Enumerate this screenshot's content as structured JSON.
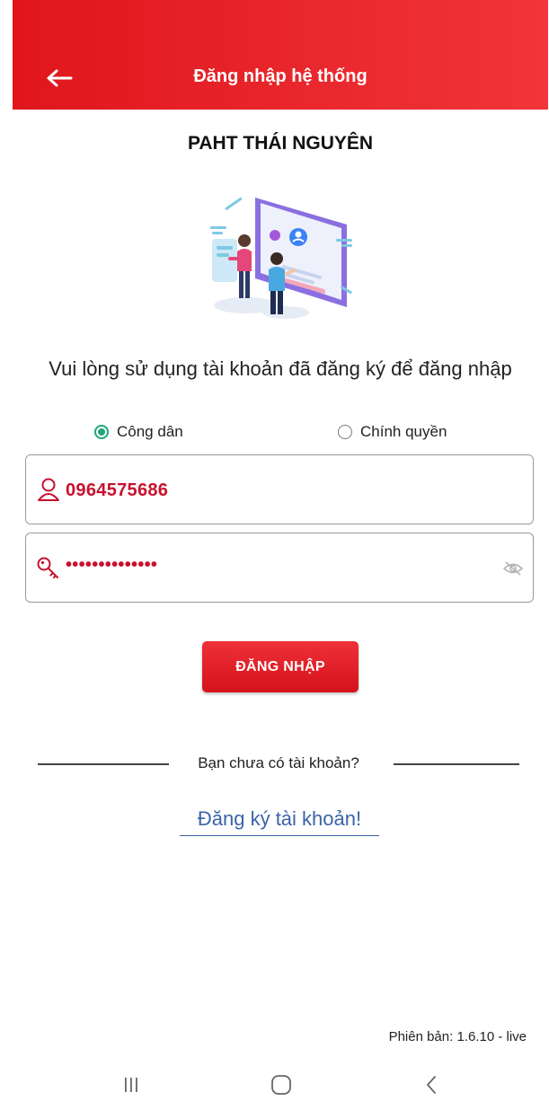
{
  "header": {
    "title": "Đăng nhập hệ thống",
    "back_icon": "arrow-left-icon",
    "gradient": [
      "#e0161c",
      "#f0353b"
    ]
  },
  "org_title": "PAHT THÁI NGUYÊN",
  "instruction": "Vui lòng sử dụng tài khoản đã đăng ký để đăng nhập",
  "account_type": {
    "options": [
      {
        "label": "Công dân",
        "checked": true
      },
      {
        "label": "Chính quyền",
        "checked": false
      }
    ],
    "accent": "#1fa67a"
  },
  "username_field": {
    "value": "0964575686",
    "icon": "user-icon"
  },
  "password_field": {
    "value": "••••••••••••••",
    "icon": "key-icon",
    "toggle_icon": "eye-off-icon"
  },
  "login_button": {
    "label": "ĐĂNG NHẬP",
    "color": "#e0161c"
  },
  "signup": {
    "prompt": "Bạn chưa có tài khoản?",
    "link": "Đăng ký tài khoản!",
    "link_color": "#3a64a8"
  },
  "version": "Phiên bản: 1.6.10 - live",
  "nav_bar": {
    "items": [
      "recent-apps-icon",
      "home-icon",
      "back-icon"
    ]
  }
}
